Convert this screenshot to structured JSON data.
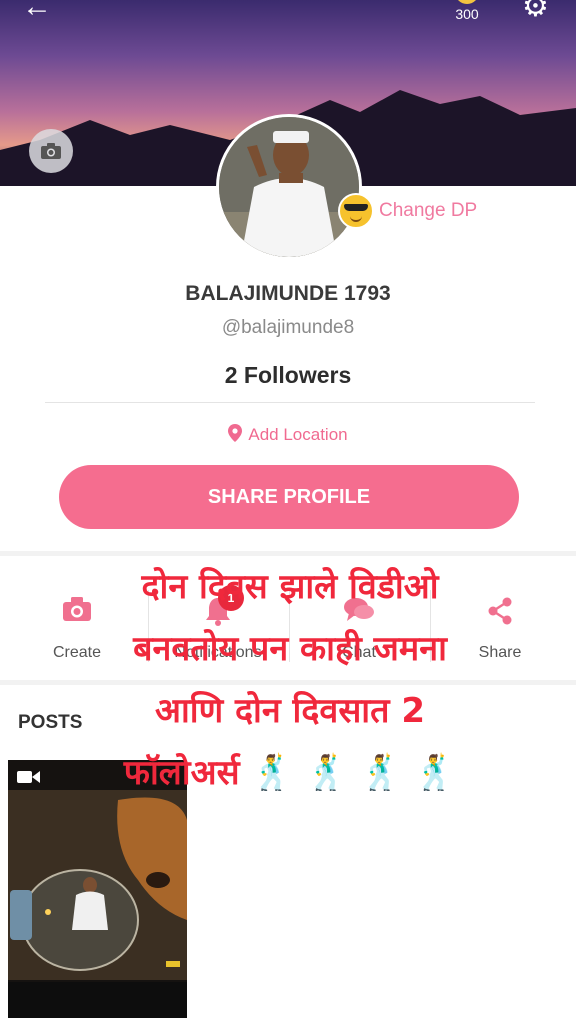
{
  "header": {
    "coins": "300"
  },
  "profile": {
    "change_dp_label": "Change DP",
    "display_name": "BALAJIMUNDE 1793",
    "handle": "@balajimunde8",
    "followers": "2 Followers",
    "location_label": "Add Location",
    "share_label": "SHARE PROFILE"
  },
  "actions": [
    {
      "label": "Create",
      "icon": "camera-icon"
    },
    {
      "label": "Notifications",
      "icon": "bell-icon",
      "badge": "1"
    },
    {
      "label": "Chat",
      "icon": "chat-icon"
    },
    {
      "label": "Share",
      "icon": "share-icon"
    }
  ],
  "posts": {
    "heading": "POSTS",
    "items": [
      {
        "type": "video",
        "icon": "video-camera-icon"
      }
    ]
  },
  "overlay_caption": {
    "lines": [
      "दोन दिवस झाले विडीओ",
      "बनवतोय पन काही जमना",
      "आणि दोन दिवसात 2",
      "फॉलोअर्स 🕺 🕺 🕺 🕺"
    ]
  },
  "colors": {
    "accent": "#f56d8f",
    "caption": "#f0283c",
    "badge": "#e8283c"
  }
}
